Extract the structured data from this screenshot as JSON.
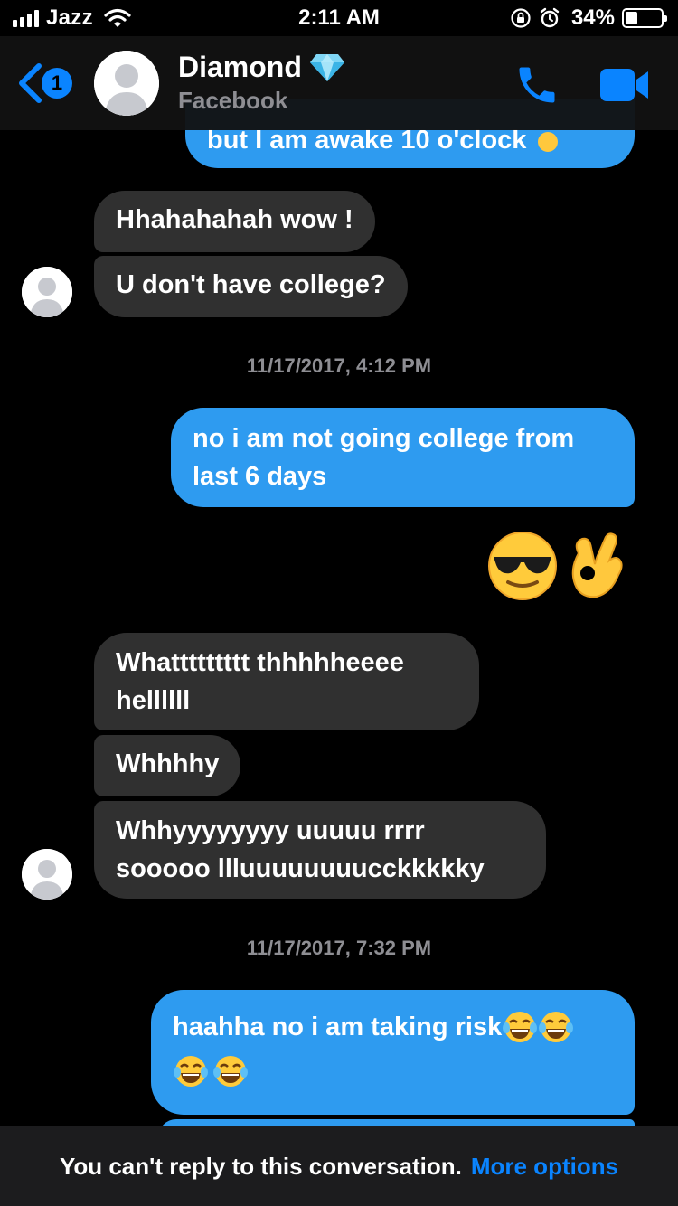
{
  "status_bar": {
    "carrier": "Jazz",
    "time": "2:11 AM",
    "battery_percent": "34%",
    "battery_level": 0.34
  },
  "header": {
    "back_badge": "1",
    "contact_name": "Diamond",
    "contact_sub": "Facebook",
    "icons": [
      "back-chevron-icon",
      "diamond-icon",
      "phone-icon",
      "video-camera-icon"
    ]
  },
  "messages": [
    {
      "side": "out",
      "text": "but I am awake 10 o'clock"
    },
    {
      "side": "in",
      "text": "Hhahahahah wow !"
    },
    {
      "side": "in",
      "text": "U don't have college?"
    },
    {
      "type": "timestamp",
      "text": "11/17/2017, 4:12 PM"
    },
    {
      "side": "out",
      "line1": "no i am not going college from",
      "line2": "last 6 days"
    },
    {
      "side": "out",
      "type": "emoji",
      "emojis": [
        "sunglasses-emoji",
        "ok-hand-emoji"
      ]
    },
    {
      "side": "in",
      "line1": "Whattttttttt thhhhheeee",
      "line2": "hellllll"
    },
    {
      "side": "in",
      "text": "Whhhhy"
    },
    {
      "side": "in",
      "line1": "Whhyyyyyyyy uuuuu rrrr",
      "line2": "sooooo llluuuuuuuucckkkkky"
    },
    {
      "type": "timestamp",
      "text": "11/17/2017, 7:32 PM"
    },
    {
      "side": "out",
      "text": "haahha no i am taking risk",
      "emojis": [
        "tears-of-joy-emoji"
      ]
    }
  ],
  "footer": {
    "notice": "You can't reply to this conversation.",
    "more_options": "More options"
  },
  "colors": {
    "outgoing_bubble": "#2e9bf0",
    "incoming_bubble": "#303030",
    "accent": "#0a84ff",
    "background": "#000000"
  }
}
